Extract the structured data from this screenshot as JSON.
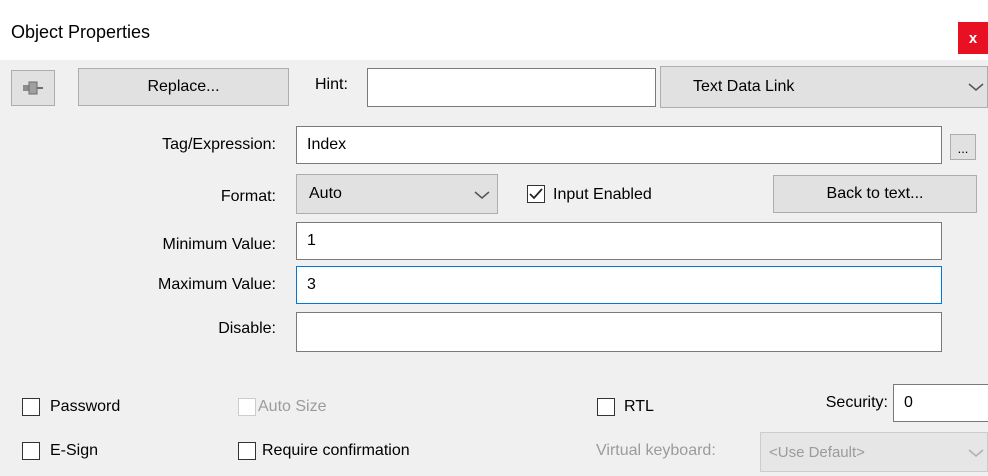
{
  "window": {
    "title": "Object Properties",
    "close_label": "x"
  },
  "toolbar": {
    "pin_icon": "pin-icon",
    "replace_label": "Replace...",
    "hint_label": "Hint:",
    "hint_value": "",
    "link_type_value": "Text Data Link"
  },
  "form": {
    "tag_label": "Tag/Expression:",
    "tag_value": "Index",
    "browse_label": "...",
    "format_label": "Format:",
    "format_value": "Auto",
    "input_enabled_label": "Input Enabled",
    "input_enabled_checked": true,
    "back_to_text_label": "Back to text...",
    "min_label": "Minimum Value:",
    "min_value": "1",
    "max_label": "Maximum Value:",
    "max_value": "3",
    "disable_label": "Disable:",
    "disable_value": ""
  },
  "options": {
    "password_label": "Password",
    "auto_size_label": "Auto Size",
    "rtl_label": "RTL",
    "security_label": "Security:",
    "security_value": "0",
    "esign_label": "E-Sign",
    "require_confirmation_label": "Require confirmation",
    "virtual_keyboard_label": "Virtual keyboard:",
    "virtual_keyboard_value": "<Use Default>"
  },
  "colors": {
    "close": "#e81123",
    "focus_border": "#0078d7"
  }
}
